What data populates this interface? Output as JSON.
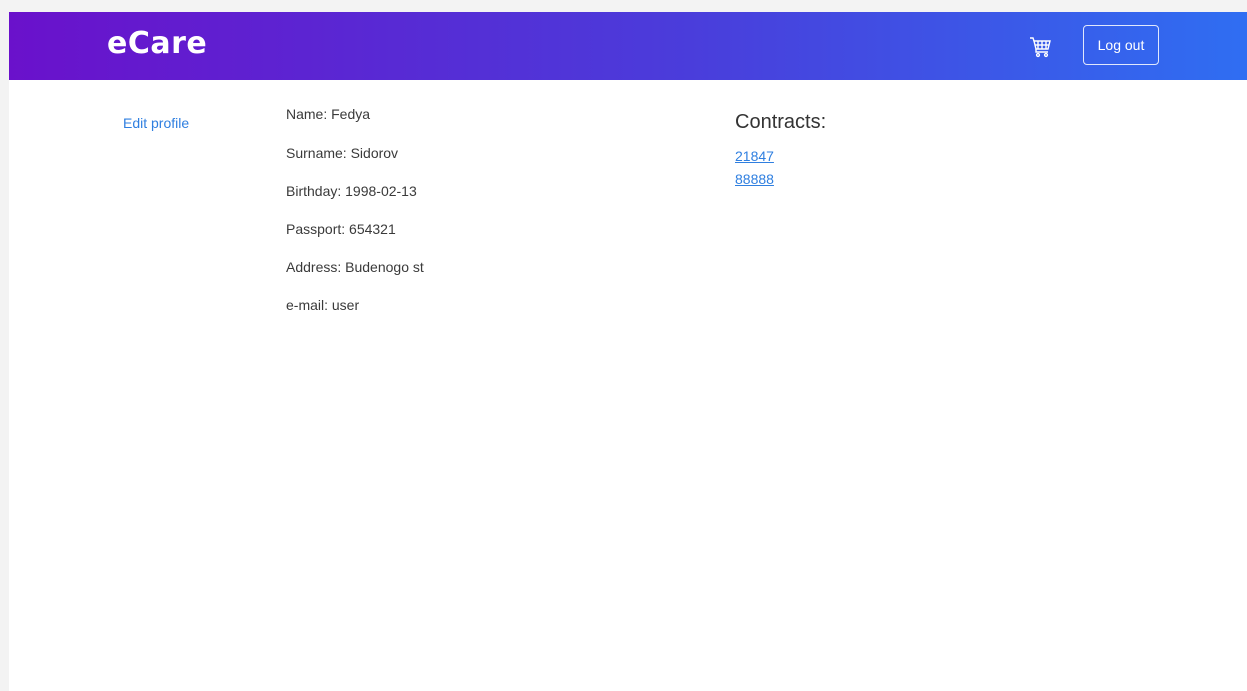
{
  "header": {
    "brand": "eCare",
    "logout_label": "Log out",
    "cart_icon": "cart-icon"
  },
  "sidebar": {
    "edit_profile_label": "Edit profile"
  },
  "profile": {
    "name": "Name: Fedya",
    "surname": "Surname: Sidorov",
    "birthday": "Birthday: 1998-02-13",
    "passport": "Passport: 654321",
    "address": "Address: Budenogo st",
    "email": "e-mail: user"
  },
  "contracts": {
    "title": "Contracts:",
    "items": [
      "21847",
      "88888"
    ]
  },
  "colors": {
    "gradient_start": "#6a11cb",
    "gradient_end": "#2f6ef2",
    "link": "#2f7fe0"
  }
}
